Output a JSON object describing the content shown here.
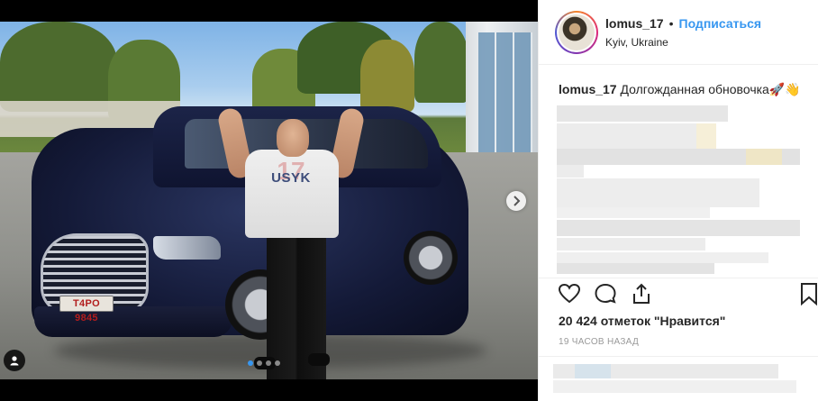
{
  "post": {
    "username": "lomus_17",
    "bullet": "•",
    "follow_label": "Подписаться",
    "location": "Kyiv, Ukraine",
    "caption_user": "lomus_17",
    "caption_text": "Долгожданная обновочка",
    "caption_emojis": "🚀👋",
    "likes": "20 424 отметок \"Нравится\"",
    "timestamp": "19 ЧАСОВ НАЗАД"
  },
  "photo": {
    "plate_text": "T4PO 9845",
    "shirt_text": "USYK",
    "shirt_number": "17",
    "carousel_dots": 4,
    "active_dot": 0
  },
  "colors": {
    "link": "#3897f0",
    "text": "#262626",
    "muted": "#999999",
    "border": "#efefef"
  },
  "icons": {
    "like": "heart-icon",
    "comment": "comment-icon",
    "share": "share-icon",
    "save": "bookmark-icon",
    "next": "chevron-right-icon",
    "tag": "user-tag-icon"
  }
}
